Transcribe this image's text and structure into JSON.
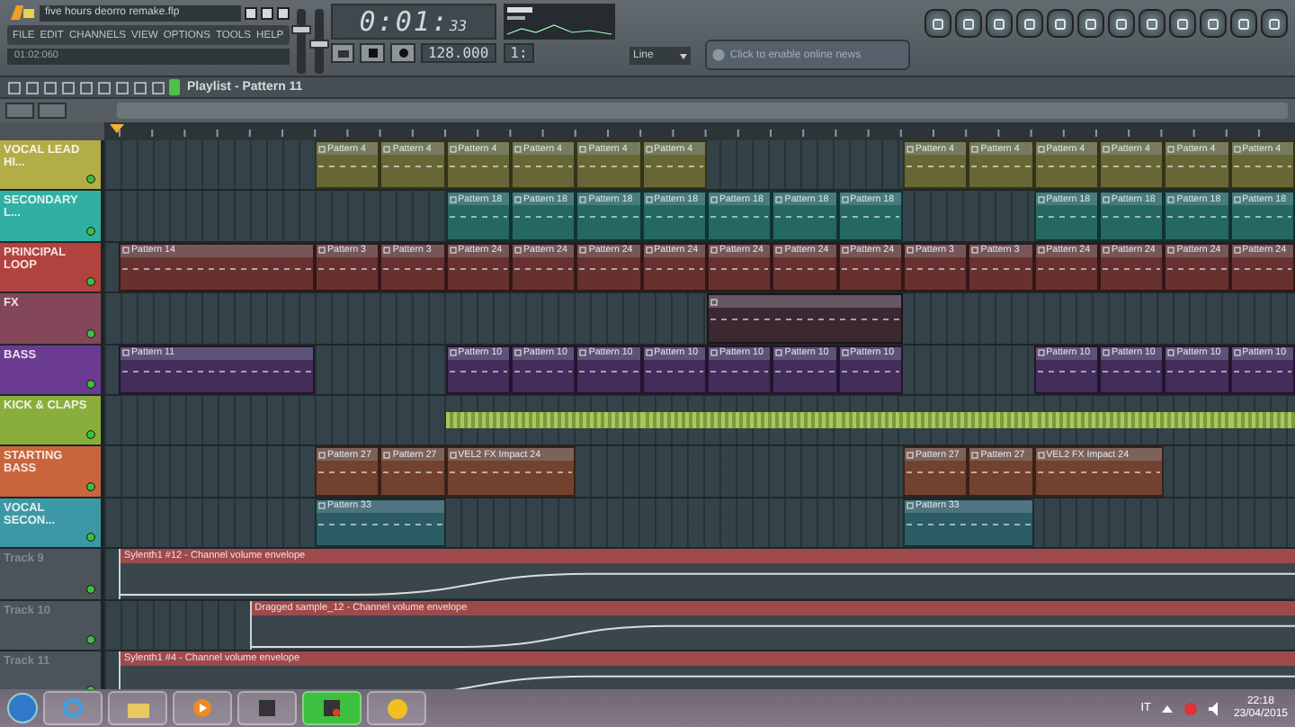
{
  "toolbar": {
    "project_title": "five hours deorro remake.flp",
    "menu": [
      "FILE",
      "EDIT",
      "CHANNELS",
      "VIEW",
      "OPTIONS",
      "TOOLS",
      "HELP"
    ],
    "hint": "01:02:060",
    "master_volume": {
      "level": 0.7
    },
    "master_pitch": {
      "level": 0.45
    },
    "time": "0:01:",
    "time_fraction": "33",
    "tempo": "128.000",
    "pattern": "1:",
    "snap": "Line",
    "news": "Click to enable online news"
  },
  "playlist": {
    "title": "Playlist - Pattern 11"
  },
  "tracks": [
    {
      "name": "VOCAL LEAD HI...",
      "color": "#b3ad48",
      "clips": [
        {
          "kind": "gap"
        },
        {
          "kind": "gap"
        },
        {
          "kind": "gap"
        },
        {
          "kind": "pattern",
          "label": "Pattern 4"
        },
        {
          "kind": "pattern",
          "label": "Pattern 4"
        },
        {
          "kind": "pattern",
          "label": "Pattern 4"
        },
        {
          "kind": "pattern",
          "label": "Pattern 4"
        },
        {
          "kind": "pattern",
          "label": "Pattern 4"
        },
        {
          "kind": "pattern",
          "label": "Pattern 4"
        },
        {
          "kind": "gap"
        },
        {
          "kind": "gap"
        },
        {
          "kind": "gap"
        },
        {
          "kind": "pattern",
          "label": "Pattern 4"
        },
        {
          "kind": "pattern",
          "label": "Pattern 4"
        },
        {
          "kind": "pattern",
          "label": "Pattern 4"
        },
        {
          "kind": "pattern",
          "label": "Pattern 4"
        },
        {
          "kind": "pattern",
          "label": "Pattern 4"
        },
        {
          "kind": "pattern",
          "label": "Pattern 4"
        }
      ]
    },
    {
      "name": "SECONDARY L...",
      "color": "#2fb0a2",
      "clips": [
        {
          "kind": "gap"
        },
        {
          "kind": "gap"
        },
        {
          "kind": "gap"
        },
        {
          "kind": "gap"
        },
        {
          "kind": "gap"
        },
        {
          "kind": "pattern",
          "label": "Pattern 18"
        },
        {
          "kind": "pattern",
          "label": "Pattern 18"
        },
        {
          "kind": "pattern",
          "label": "Pattern 18"
        },
        {
          "kind": "pattern",
          "label": "Pattern 18"
        },
        {
          "kind": "pattern",
          "label": "Pattern 18"
        },
        {
          "kind": "pattern",
          "label": "Pattern 18"
        },
        {
          "kind": "pattern",
          "label": "Pattern 18"
        },
        {
          "kind": "gap"
        },
        {
          "kind": "gap"
        },
        {
          "kind": "pattern",
          "label": "Pattern 18"
        },
        {
          "kind": "pattern",
          "label": "Pattern 18"
        },
        {
          "kind": "pattern",
          "label": "Pattern 18"
        },
        {
          "kind": "pattern",
          "label": "Pattern 18"
        }
      ]
    },
    {
      "name": "PRINCIPAL LOOP",
      "color": "#b2423d",
      "clips": [
        {
          "kind": "long",
          "label": "Pattern 14"
        },
        {
          "kind": "pattern",
          "label": "Pattern 3"
        },
        {
          "kind": "pattern",
          "label": "Pattern 3"
        },
        {
          "kind": "pattern",
          "label": "Pattern 24"
        },
        {
          "kind": "pattern",
          "label": "Pattern 24"
        },
        {
          "kind": "pattern",
          "label": "Pattern 24"
        },
        {
          "kind": "pattern",
          "label": "Pattern 24"
        },
        {
          "kind": "pattern",
          "label": "Pattern 24"
        },
        {
          "kind": "pattern",
          "label": "Pattern 24"
        },
        {
          "kind": "pattern",
          "label": "Pattern 24"
        },
        {
          "kind": "pattern",
          "label": "Pattern 3"
        },
        {
          "kind": "pattern",
          "label": "Pattern 3"
        },
        {
          "kind": "pattern",
          "label": "Pattern 24"
        },
        {
          "kind": "pattern",
          "label": "Pattern 24"
        },
        {
          "kind": "pattern",
          "label": "Pattern 24"
        },
        {
          "kind": "pattern",
          "label": "Pattern 24"
        }
      ]
    },
    {
      "name": "FX",
      "color": "#84475a",
      "clips": [
        {
          "kind": "gap"
        },
        {
          "kind": "gap"
        },
        {
          "kind": "gap"
        },
        {
          "kind": "gap"
        },
        {
          "kind": "gap"
        },
        {
          "kind": "gap"
        },
        {
          "kind": "gap"
        },
        {
          "kind": "gap"
        },
        {
          "kind": "gap"
        },
        {
          "kind": "sample"
        }
      ]
    },
    {
      "name": "BASS",
      "color": "#6b3b92",
      "clips": [
        {
          "kind": "long",
          "label": "Pattern 11"
        },
        {
          "kind": "gap"
        },
        {
          "kind": "gap"
        },
        {
          "kind": "pattern",
          "label": "Pattern 10"
        },
        {
          "kind": "pattern",
          "label": "Pattern 10"
        },
        {
          "kind": "pattern",
          "label": "Pattern 10"
        },
        {
          "kind": "pattern",
          "label": "Pattern 10"
        },
        {
          "kind": "pattern",
          "label": "Pattern 10"
        },
        {
          "kind": "pattern",
          "label": "Pattern 10"
        },
        {
          "kind": "pattern",
          "label": "Pattern 10"
        },
        {
          "kind": "gap"
        },
        {
          "kind": "gap"
        },
        {
          "kind": "pattern",
          "label": "Pattern 10"
        },
        {
          "kind": "pattern",
          "label": "Pattern 10"
        },
        {
          "kind": "pattern",
          "label": "Pattern 10"
        },
        {
          "kind": "pattern",
          "label": "Pattern 10"
        }
      ]
    },
    {
      "name": "KICK & CLAPS",
      "color": "#8aae3c",
      "clips": [
        {
          "kind": "gap"
        },
        {
          "kind": "gap"
        },
        {
          "kind": "gap"
        },
        {
          "kind": "gap"
        },
        {
          "kind": "gap"
        },
        {
          "kind": "beat"
        },
        {
          "kind": "beat"
        },
        {
          "kind": "beat"
        },
        {
          "kind": "beat"
        },
        {
          "kind": "beat"
        },
        {
          "kind": "beat"
        },
        {
          "kind": "beat"
        },
        {
          "kind": "beat"
        },
        {
          "kind": "beat"
        },
        {
          "kind": "beat"
        },
        {
          "kind": "beat"
        },
        {
          "kind": "beat"
        },
        {
          "kind": "beat"
        }
      ]
    },
    {
      "name": "STARTING BASS",
      "color": "#c8653c",
      "clips": [
        {
          "kind": "gap"
        },
        {
          "kind": "gap"
        },
        {
          "kind": "gap"
        },
        {
          "kind": "pattern",
          "label": "Pattern 27"
        },
        {
          "kind": "pattern",
          "label": "Pattern 27"
        },
        {
          "kind": "double",
          "label": "VEL2 FX Impact 24"
        },
        {
          "kind": "gap"
        },
        {
          "kind": "gap"
        },
        {
          "kind": "gap"
        },
        {
          "kind": "gap"
        },
        {
          "kind": "gap"
        },
        {
          "kind": "pattern",
          "label": "Pattern 27"
        },
        {
          "kind": "pattern",
          "label": "Pattern 27"
        },
        {
          "kind": "double",
          "label": "VEL2 FX Impact 24"
        }
      ]
    },
    {
      "name": "VOCAL SECON...",
      "color": "#3d98a6",
      "clips": [
        {
          "kind": "gap"
        },
        {
          "kind": "gap"
        },
        {
          "kind": "gap"
        },
        {
          "kind": "double",
          "label": "Pattern 33"
        },
        {
          "kind": "gap"
        },
        {
          "kind": "gap"
        },
        {
          "kind": "gap"
        },
        {
          "kind": "gap"
        },
        {
          "kind": "gap"
        },
        {
          "kind": "gap"
        },
        {
          "kind": "gap"
        },
        {
          "kind": "double",
          "label": "Pattern 33"
        }
      ]
    },
    {
      "name": "Track 9",
      "color": "#4a545a",
      "clips": [
        {
          "kind": "automation",
          "label": "Sylenth1 #12 - Channel volume envelope"
        }
      ]
    },
    {
      "name": "Track 10",
      "color": "#4a545a",
      "clips": [
        {
          "kind": "gap"
        },
        {
          "kind": "gap"
        },
        {
          "kind": "automation",
          "label": "Dragged sample_12 - Channel volume envelope"
        }
      ]
    },
    {
      "name": "Track 11",
      "color": "#4a545a",
      "clips": [
        {
          "kind": "automation",
          "label": "Sylenth1 #4 - Channel volume envelope"
        }
      ]
    }
  ],
  "taskbar": {
    "language": "IT",
    "time": "22:18",
    "date": "23/04/2015"
  }
}
